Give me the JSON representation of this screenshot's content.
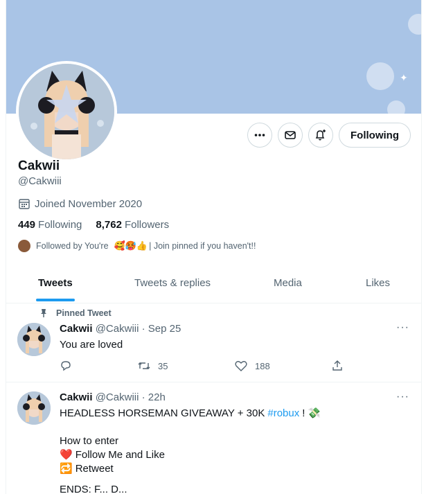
{
  "profile": {
    "name": "Cakwii",
    "handle": "@Cakwiii",
    "joined": "Joined November 2020",
    "following_count": "449",
    "following_label": "Following",
    "followers_count": "8,762",
    "followers_label": "Followers",
    "followed_by": "Followed by You're",
    "followed_by_suffix": "| Join pinned if you haven't!!",
    "follow_button": "Following"
  },
  "tabs": [
    "Tweets",
    "Tweets & replies",
    "Media",
    "Likes"
  ],
  "pinned_label": "Pinned Tweet",
  "tweets": [
    {
      "name": "Cakwii",
      "handle": "@Cakwiii",
      "time": "· Sep 25",
      "text": "You are loved",
      "retweets": "35",
      "likes": "188"
    },
    {
      "name": "Cakwii",
      "handle": "@Cakwiii",
      "time": "· 22h",
      "line1_text": "HEADLESS HORSEMAN GIVEAWAY + 30K",
      "line1_hashtag": "#robux",
      "line1_after": "!",
      "line2": "How to enter",
      "line3": "Follow Me and Like",
      "line4": "Retweet",
      "line5": "ENDS: F... D..."
    }
  ],
  "colors": {
    "accent": "#1d9bf0",
    "banner": "#a9c4e6",
    "muted": "#536471"
  }
}
